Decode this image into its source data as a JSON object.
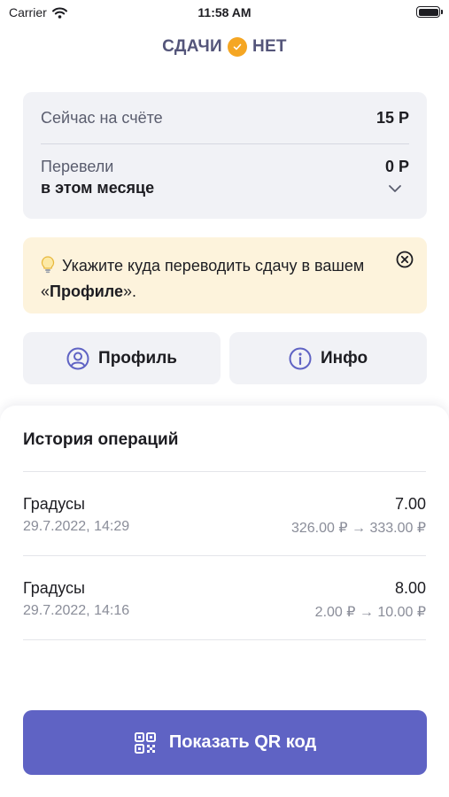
{
  "status_bar": {
    "carrier": "Carrier",
    "time": "11:58 AM"
  },
  "header": {
    "left": "СДАЧИ",
    "right": "НЕТ",
    "accent_color": "#f5a623"
  },
  "balance": {
    "label": "Сейчас на счёте",
    "value": "15 Р",
    "transfer_label": "Перевели",
    "transfer_period": "в этом месяце",
    "transfer_value": "0 Р"
  },
  "notice": {
    "text_before": "Укажите куда переводить сдачу в вашем «",
    "text_bold": "Профиле",
    "text_after": "».",
    "bg_color": "#fdf3dc"
  },
  "actions": {
    "profile_label": "Профиль",
    "info_label": "Инфо"
  },
  "history": {
    "title": "История операций",
    "items": [
      {
        "name": "Градусы",
        "date": "29.7.2022, 14:29",
        "amount": "7.00",
        "change": "326.00 ₽ → 333.00 ₽"
      },
      {
        "name": "Градусы",
        "date": "29.7.2022, 14:16",
        "amount": "8.00",
        "change": "2.00 ₽ → 10.00 ₽"
      }
    ]
  },
  "qr_button": {
    "label": "Показать QR код",
    "color": "#5f63c4"
  }
}
